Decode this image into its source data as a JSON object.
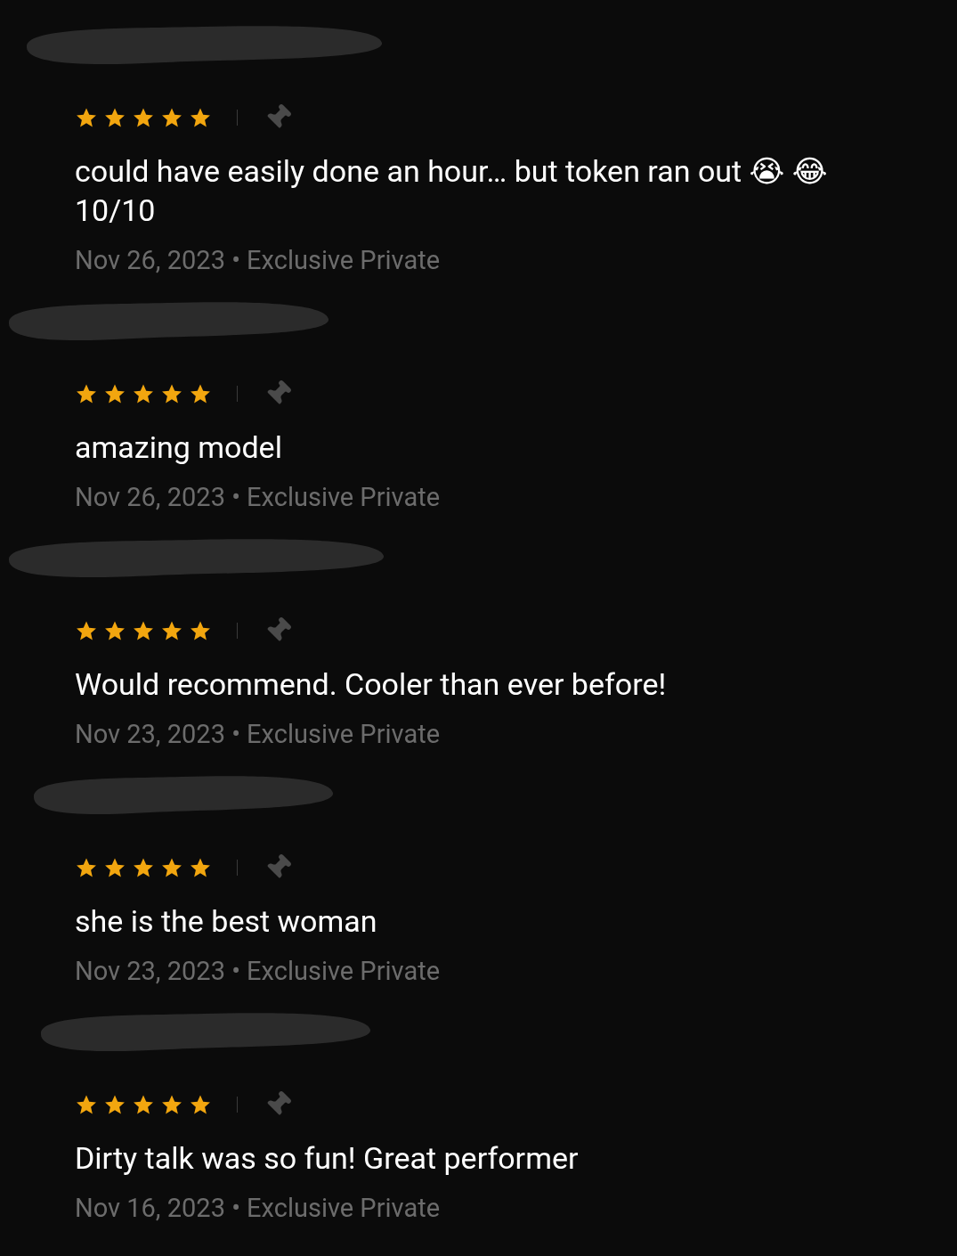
{
  "reviews": [
    {
      "stars": 5,
      "pinned": false,
      "text": "could have easily done an hour… but token ran out 😭 😂 10/10",
      "meta": "Nov 26, 2023 • Exclusive Private"
    },
    {
      "stars": 5,
      "pinned": false,
      "text": "amazing model",
      "meta": "Nov 26, 2023 • Exclusive Private"
    },
    {
      "stars": 5,
      "pinned": false,
      "text": "Would recommend. Cooler than ever before!",
      "meta": "Nov 23, 2023 • Exclusive Private"
    },
    {
      "stars": 5,
      "pinned": false,
      "text": "she is the best woman",
      "meta": "Nov 23, 2023 • Exclusive Private"
    },
    {
      "stars": 5,
      "pinned": false,
      "text": "Dirty talk was so fun! Great performer",
      "meta": "Nov 16, 2023 • Exclusive Private"
    }
  ]
}
